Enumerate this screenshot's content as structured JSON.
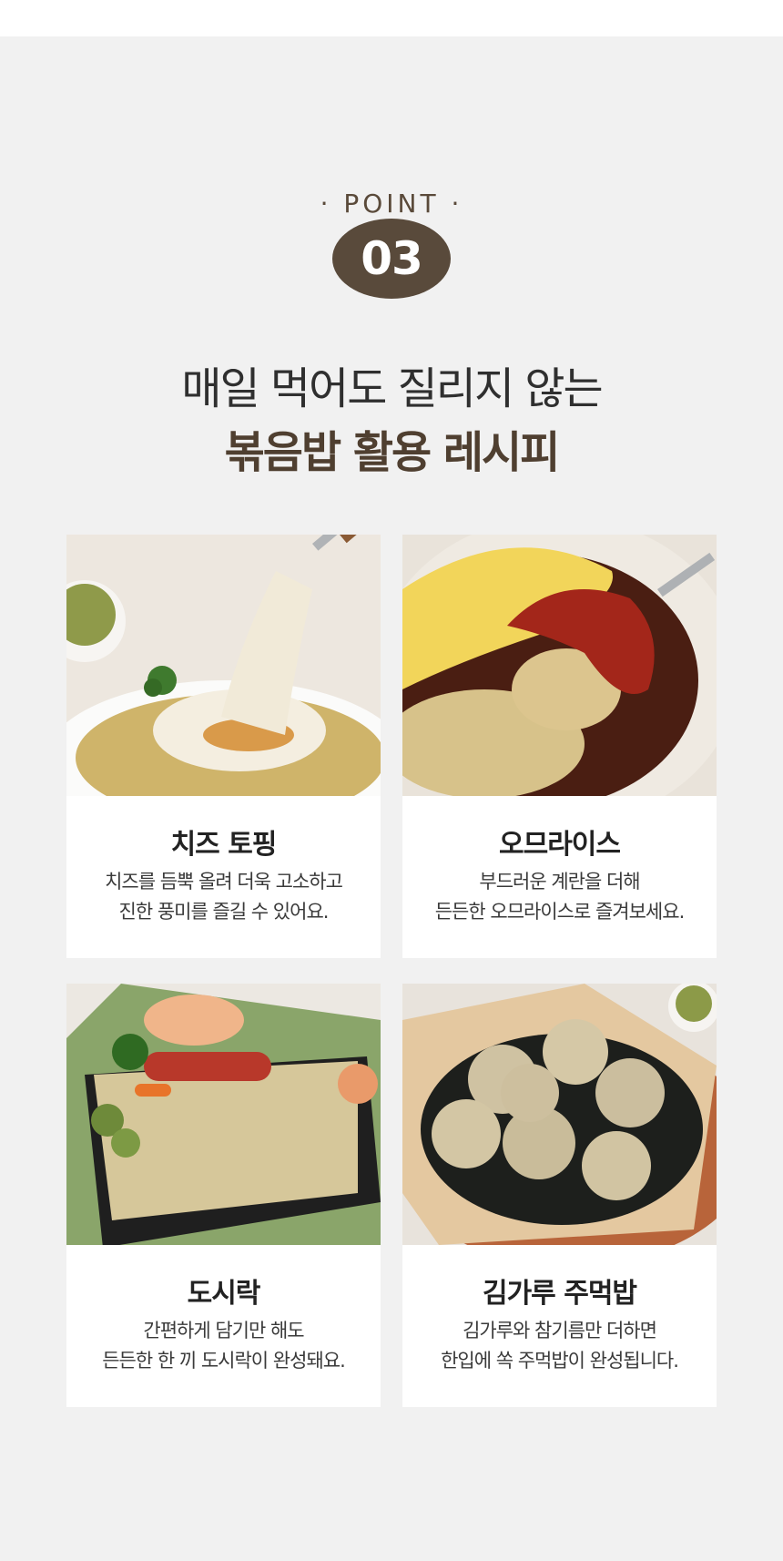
{
  "point": {
    "label": "· POINT ·",
    "number": "03"
  },
  "headline": {
    "line1": "매일 먹어도 질리지 않는",
    "line2": "볶음밥 활용 레시피"
  },
  "cards": [
    {
      "title": "치즈 토핑",
      "desc1": "치즈를 듬뿍 올려 더욱 고소하고",
      "desc2": "진한 풍미를 즐길 수 있어요.",
      "image": "cheese-fried-rice-photo"
    },
    {
      "title": "오므라이스",
      "desc1": "부드러운 계란을 더해",
      "desc2": "든든한 오므라이스로 즐겨보세요.",
      "image": "omurice-photo"
    },
    {
      "title": "도시락",
      "desc1": "간편하게 담기만 해도",
      "desc2": "든든한 한 끼 도시락이 완성돼요.",
      "image": "lunchbox-photo"
    },
    {
      "title": "김가루 주먹밥",
      "desc1": "김가루와 참기름만 더하면",
      "desc2": "한입에 쏙 주먹밥이 완성됩니다.",
      "image": "rice-ball-photo"
    }
  ],
  "colors": {
    "accent": "#594a3b",
    "background": "#f1f1f1",
    "card": "#ffffff"
  }
}
